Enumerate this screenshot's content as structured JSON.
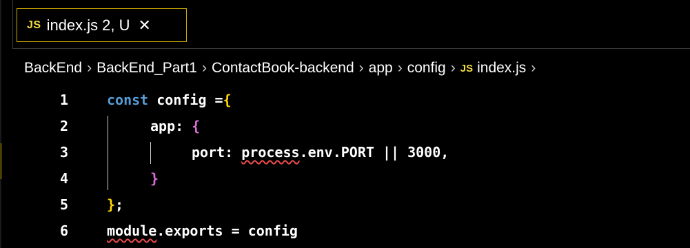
{
  "tab": {
    "badge": "JS",
    "filename": "index.js",
    "status": "2, U",
    "close_glyph": "✕"
  },
  "breadcrumb": {
    "items": [
      "BackEnd",
      "BackEnd_Part1",
      "ContactBook-backend",
      "app",
      "config"
    ],
    "file_badge": "JS",
    "file": "index.js",
    "separator": "›"
  },
  "editor": {
    "line_numbers": [
      "1",
      "2",
      "3",
      "4",
      "5",
      "6"
    ],
    "lines": {
      "l1": {
        "kw": "const",
        "rest": " config =",
        "brace": "{"
      },
      "l2": {
        "key": "app: ",
        "brace": "{"
      },
      "l3": {
        "key": "port: ",
        "process": "process",
        "rest": ".env.PORT || 3000,"
      },
      "l4": {
        "brace": "}"
      },
      "l5": {
        "brace": "}",
        "semi": ";"
      },
      "l6": {
        "module": "module",
        "rest": ".exports = config"
      }
    }
  },
  "colors": {
    "keyword": "#569cd6",
    "bracket_level1": "#ffd700",
    "bracket_level2": "#da70d6",
    "error_squiggle": "#f14c4c",
    "tab_border": "#d4b100",
    "js_badge": "#f1dd3f"
  }
}
